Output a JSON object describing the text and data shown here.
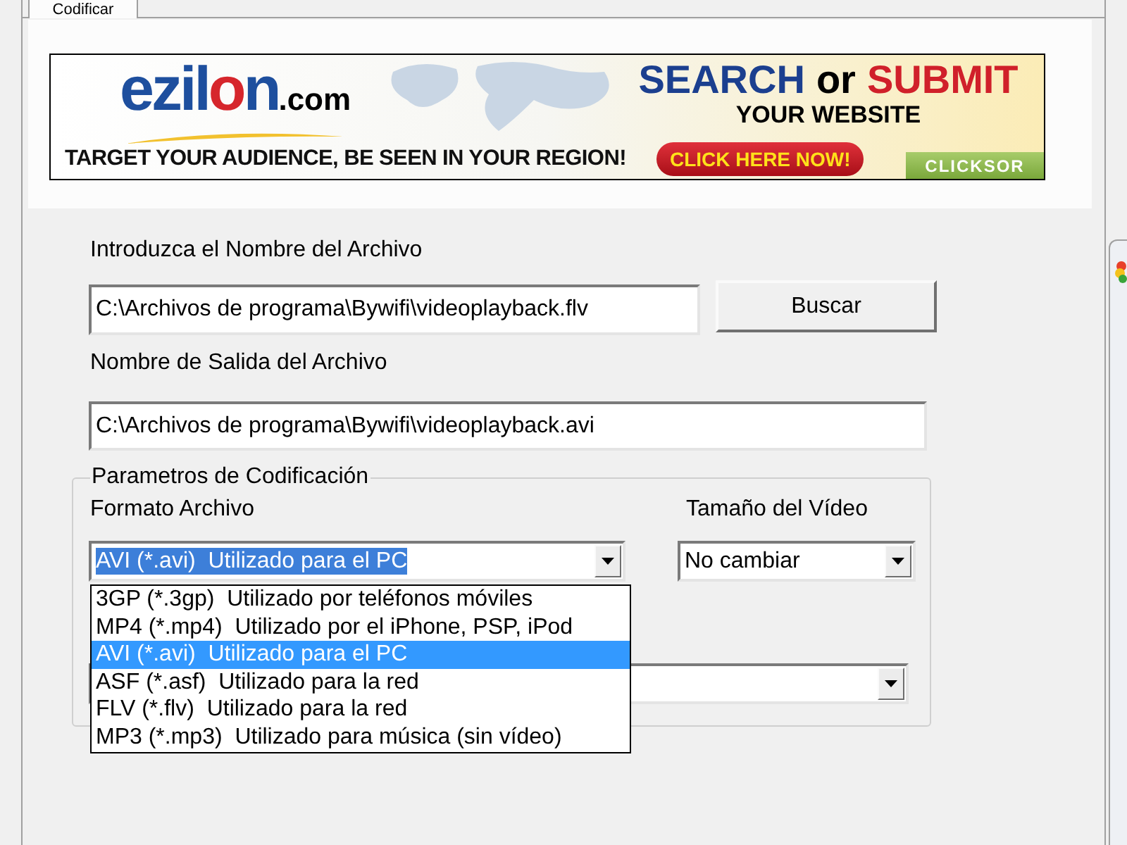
{
  "tabs": [
    {
      "label": "Codificar",
      "selected": true
    }
  ],
  "banner": {
    "logo": {
      "parts": [
        {
          "text": "ezil",
          "color": "#1e4f9e"
        },
        {
          "text": "o",
          "color": "#d6262c"
        },
        {
          "text": "n",
          "color": "#1e4f9e"
        }
      ],
      "domain": ".com"
    },
    "headline": [
      {
        "text": "SEARCH",
        "color": "#1b3f8f"
      },
      {
        "text": "or",
        "color": "#000000"
      },
      {
        "text": "SUBMIT",
        "color": "#d0202a"
      }
    ],
    "subheadline": "YOUR WEBSITE",
    "tagline": "TARGET YOUR AUDIENCE, BE SEEN IN YOUR REGION!",
    "cta": "CLICK HERE NOW!",
    "badge": "CLICKSOR"
  },
  "input_file": {
    "label": "Introduzca el Nombre del Archivo",
    "value": "C:\\Archivos de programa\\Bywifi\\videoplayback.flv"
  },
  "browse_button": {
    "label": "Buscar"
  },
  "output_file": {
    "label": "Nombre de Salida del Archivo",
    "value": "C:\\Archivos de programa\\Bywifi\\videoplayback.avi"
  },
  "encoding": {
    "title": "Parametros de Codificación",
    "format": {
      "label": "Formato Archivo",
      "value": "AVI (*.avi)  Utilizado para el PC",
      "value_highlighted": true,
      "expanded": true,
      "options": [
        {
          "label": "3GP (*.3gp)  Utilizado por teléfonos móviles",
          "selected": false
        },
        {
          "label": "MP4 (*.mp4)  Utilizado por el iPhone, PSP, iPod",
          "selected": false
        },
        {
          "label": "AVI (*.avi)  Utilizado para el PC",
          "selected": true
        },
        {
          "label": "ASF (*.asf)  Utilizado para la red",
          "selected": false
        },
        {
          "label": "FLV (*.flv)  Utilizado para la red",
          "selected": false
        },
        {
          "label": "MP3 (*.mp3)  Utilizado para música (sin vídeo)",
          "selected": false
        }
      ]
    },
    "video_size": {
      "label": "Tamaño del Vídeo",
      "value": "No cambiar"
    }
  }
}
